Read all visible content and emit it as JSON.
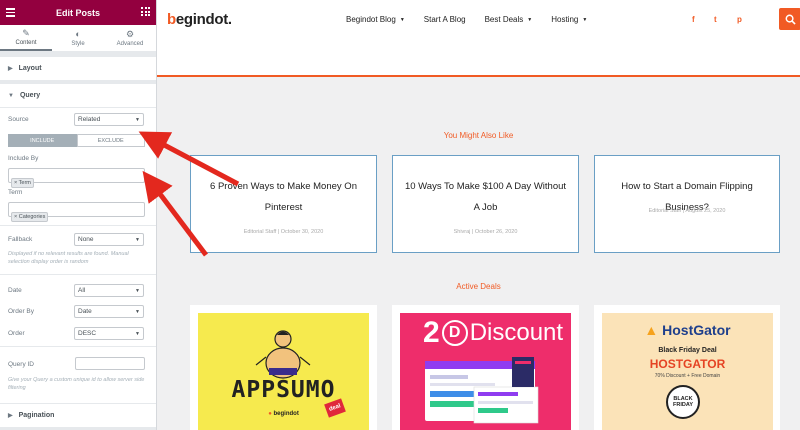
{
  "panel": {
    "title": "Edit Posts",
    "tabs": [
      {
        "label": "Content",
        "icon": "pencil-icon"
      },
      {
        "label": "Style",
        "icon": "contrast-icon"
      },
      {
        "label": "Advanced",
        "icon": "gear-icon"
      }
    ],
    "sections": {
      "layout": "Layout",
      "query": "Query",
      "pagination": "Pagination"
    },
    "query": {
      "source_label": "Source",
      "source_value": "Related",
      "include_tab": "INCLUDE",
      "exclude_tab": "EXCLUDE",
      "include_by_label": "Include By",
      "include_by_tag": "Term",
      "term_label": "Term",
      "term_tag": "Categories",
      "fallback_label": "Fallback",
      "fallback_value": "None",
      "fallback_help": "Displayed if no relevant results are found. Manual selection display order is random",
      "date_label": "Date",
      "date_value": "All",
      "order_by_label": "Order By",
      "order_by_value": "Date",
      "order_label": "Order",
      "order_value": "DESC",
      "query_id_label": "Query ID",
      "query_id_help": "Give your Query a custom unique id to allow server side filtering"
    }
  },
  "site": {
    "logo_mark": "b",
    "logo_text": "egindot.",
    "nav": [
      {
        "label": "Begindot Blog",
        "dropdown": true
      },
      {
        "label": "Start A Blog",
        "dropdown": false
      },
      {
        "label": "Best Deals",
        "dropdown": true
      },
      {
        "label": "Hosting",
        "dropdown": true
      }
    ],
    "social": [
      "f",
      "t",
      "p"
    ],
    "accent_color": "#f15a24",
    "related_heading": "You Might Also Like",
    "posts": [
      {
        "title": "6 Proven Ways to Make Money On Pinterest",
        "meta": "Editorial Staff | October 30, 2020"
      },
      {
        "title": "10 Ways To Make $100 A Day Without A Job",
        "meta": "Shivraj | October 26, 2020"
      },
      {
        "title": "How to Start a Domain Flipping Business?",
        "meta": "Editorial Staff | August 25, 2020"
      }
    ],
    "deals_heading": "Active Deals",
    "deals": [
      {
        "name": "APPSUMO",
        "sub": "begindot",
        "badge": "deal"
      },
      {
        "name": "Discount",
        "prefix": "2",
        "letter": "D"
      },
      {
        "name": "HostGator",
        "line1": "Black Friday Deal",
        "line2": "HOSTGATOR",
        "line3": "70% Discount + Free Domain",
        "badge1": "BLACK",
        "badge2": "FRIDAY"
      }
    ]
  }
}
